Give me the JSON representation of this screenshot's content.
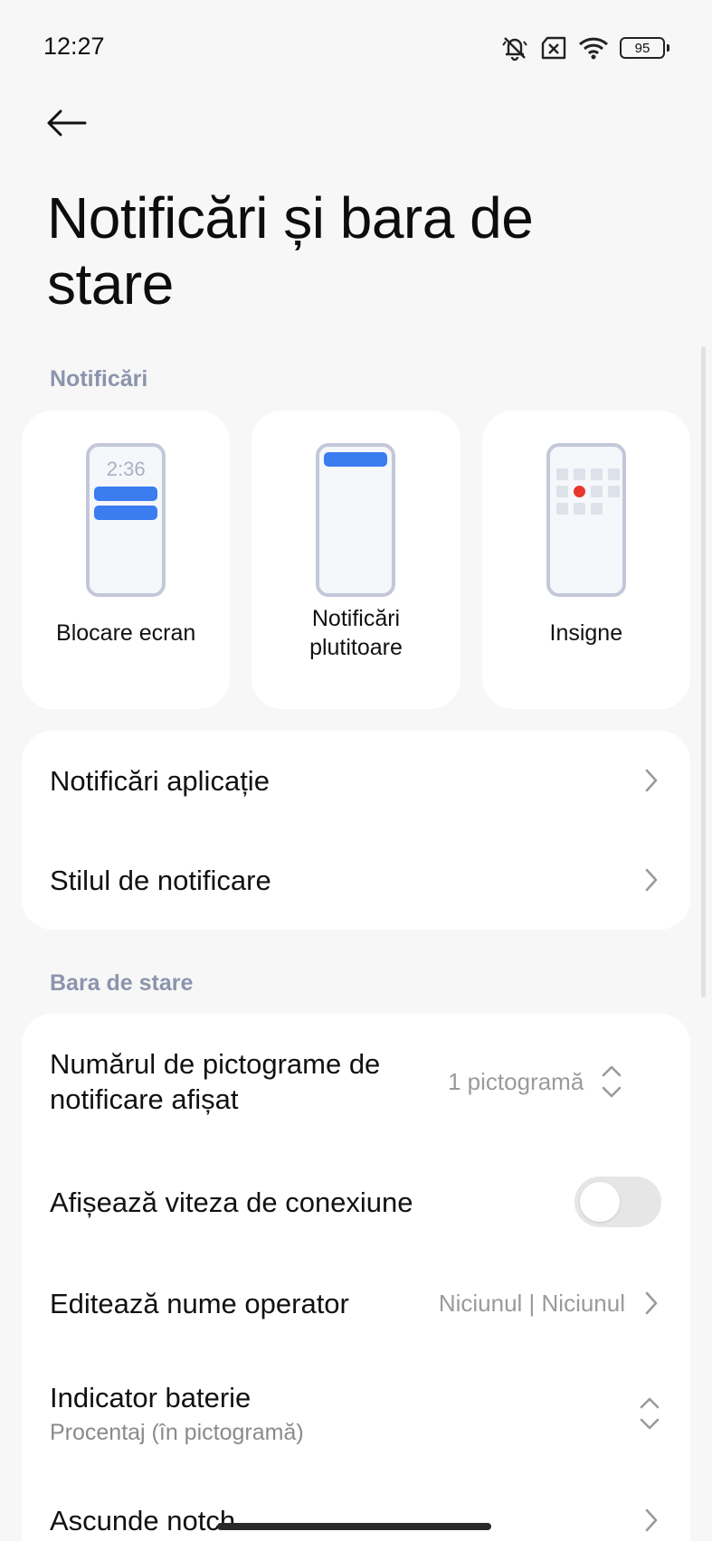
{
  "status_bar": {
    "time": "12:27",
    "battery_level": "95"
  },
  "header": {
    "title": "Notificări și bara de stare"
  },
  "sections": {
    "notifications": "Notificări",
    "status_bar": "Bara de stare"
  },
  "notification_styles": [
    {
      "label": "Blocare ecran",
      "preview_time": "2:36"
    },
    {
      "label": "Notificări plutitoare"
    },
    {
      "label": "Insigne"
    }
  ],
  "notification_rows": [
    {
      "title": "Notificări aplicație"
    },
    {
      "title": "Stilul de notificare"
    }
  ],
  "status_rows": {
    "icon_count": {
      "title": "Numărul de pictograme de notificare afișat",
      "value": "1 pictogramă"
    },
    "connection_speed": {
      "title": "Afișează viteza de conexiune",
      "enabled": false
    },
    "carrier_name": {
      "title": "Editează nume operator",
      "value": "Niciunul | Niciunul"
    },
    "battery_indicator": {
      "title": "Indicator baterie",
      "subtitle": "Procentaj (în pictogramă)"
    },
    "hide_notch": {
      "title": "Ascunde notch"
    }
  },
  "colors": {
    "accent": "#3b7cf0",
    "badge_dot": "#e8372c",
    "section_header": "#8c94ad"
  }
}
